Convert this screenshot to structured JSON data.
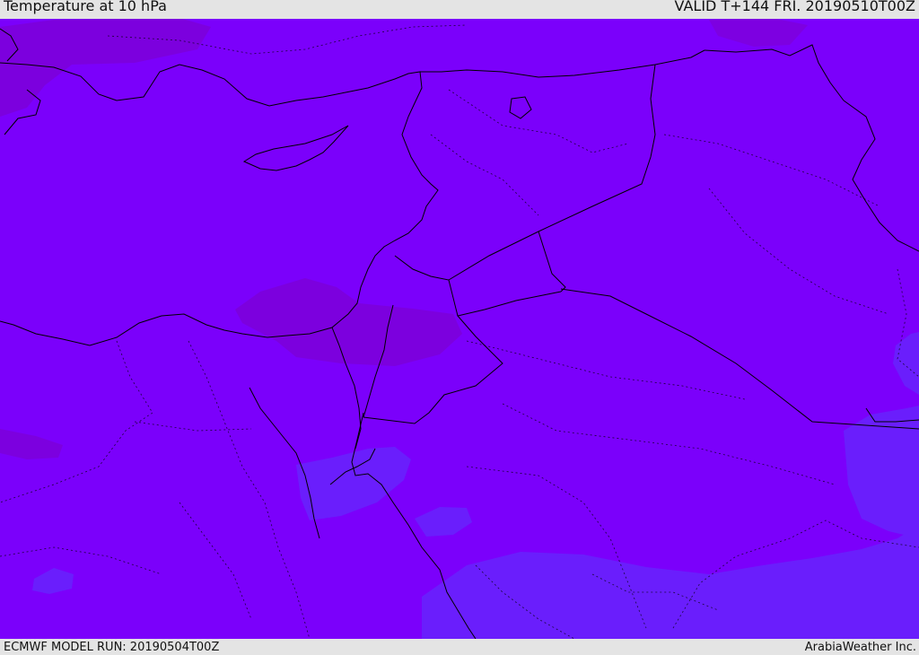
{
  "header": {
    "title": "Temperature at 10 hPa",
    "valid": "VALID T+144 FRI. 20190510T00Z"
  },
  "footer": {
    "model_run": "ECMWF MODEL RUN: 20190504T00Z",
    "credit": "ArabiaWeather Inc."
  },
  "map": {
    "variable": "Temperature",
    "level": "10 hPa",
    "colors": {
      "base_field": "#7b00fb",
      "warm_patch": "#7d00d8",
      "cool_patch": "#6a1efc",
      "coastline": "#000000",
      "border": "#000000"
    }
  }
}
